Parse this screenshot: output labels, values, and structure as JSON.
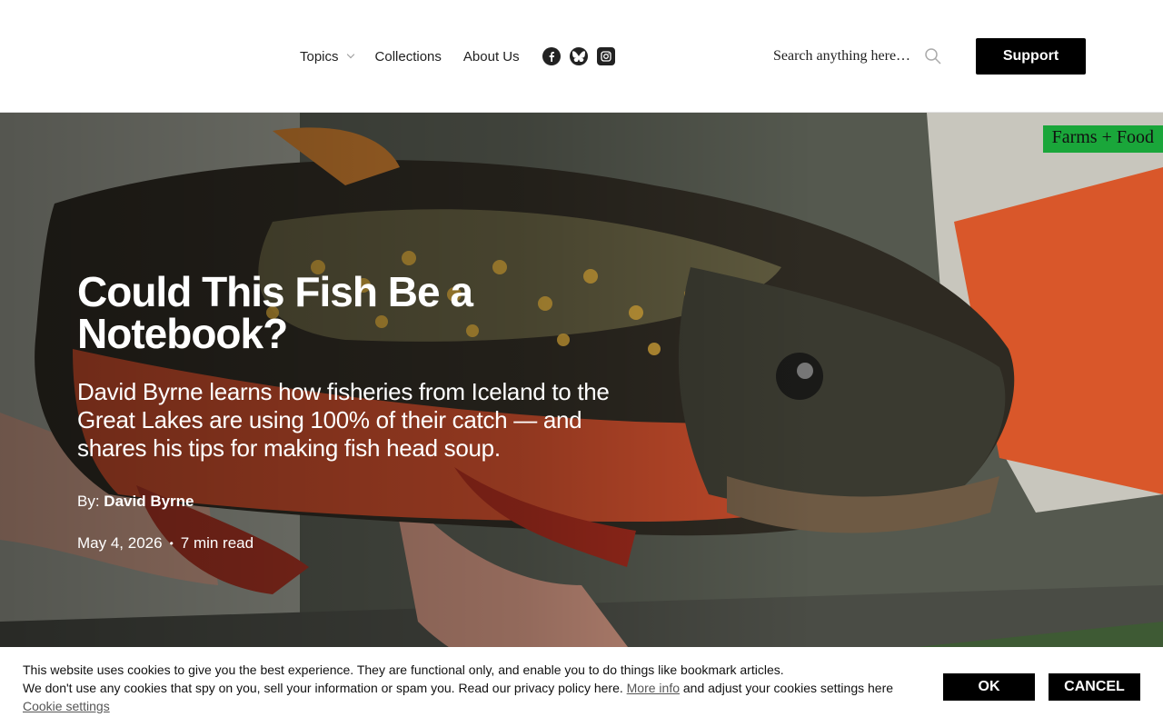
{
  "header": {
    "nav": [
      {
        "label": "Topics"
      },
      {
        "label": "Collections"
      },
      {
        "label": "About Us"
      }
    ],
    "social": [
      "facebook-icon",
      "bluesky-icon",
      "instagram-icon"
    ],
    "search": {
      "placeholder": "Search anything here…"
    },
    "support_label": "Support"
  },
  "article": {
    "category_tag": "Farms + Food",
    "title": "Could This Fish Be a Notebook?",
    "dek": "David Byrne learns how fisheries from Iceland to the Great Lakes are using 100% of their catch — and shares his tips for making fish head soup.",
    "by_label": "By:",
    "author": "David Byrne",
    "date": "May 4, 2026",
    "separator": "•",
    "read_time": "7 min read"
  },
  "cookie": {
    "line1": "This website uses cookies to give you the best experience. They are functional only, and enable you to do things like bookmark articles.",
    "line2_pre": "We don't use any cookies that spy on you, sell your information or spam you. Read our privacy policy here.",
    "more_info": "More info",
    "line2_mid": "and adjust your cookies settings here",
    "settings_link": "Cookie settings",
    "ok_label": "OK",
    "cancel_label": "CANCEL"
  },
  "colors": {
    "tag_bg": "#1aa63a",
    "button_bg": "#000000"
  }
}
